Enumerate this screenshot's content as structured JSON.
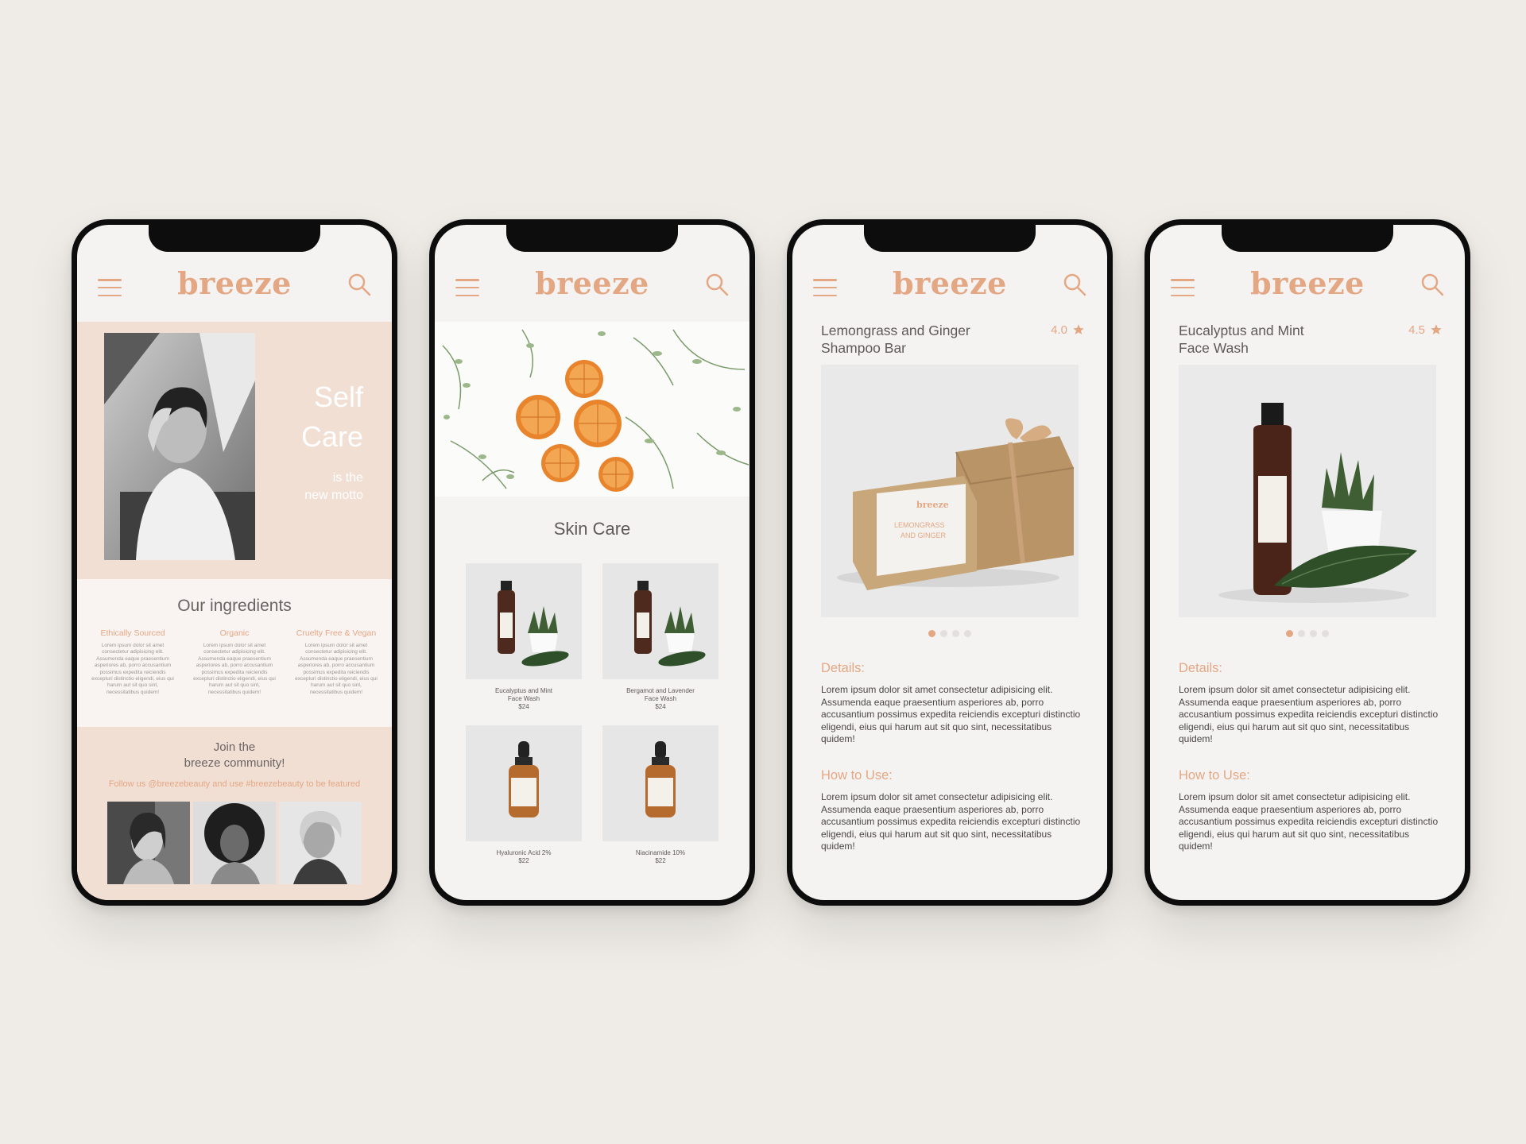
{
  "brand": {
    "logo": "breeze",
    "accent": "#e4a784",
    "blush": "#f1dfd4",
    "icons": {
      "menu": "hamburger-menu-icon",
      "search": "magnifier-search-icon",
      "star": "star-icon"
    }
  },
  "home": {
    "hero": {
      "title_line1": "Self",
      "title_line2": "Care",
      "sub_line1": "is the",
      "sub_line2": "new motto"
    },
    "ingredients": {
      "title": "Our ingredients",
      "columns": [
        {
          "heading": "Ethically Sourced",
          "text": "Lorem ipsum dolor sit amet consectetur adipisicing elit. Assumenda eaque praesentium asperiores ab, porro accusantium possimus expedita reiciendis excepturi distinctio eligendi, eius qui harum aut sit quo sint, necessitatibus quidem!"
        },
        {
          "heading": "Organic",
          "text": "Lorem ipsum dolor sit amet consectetur adipisicing elit. Assumenda eaque praesentium asperiores ab, porro accusantium possimus expedita reiciendis excepturi distinctio eligendi, eius qui harum aut sit quo sint, necessitatibus quidem!"
        },
        {
          "heading": "Cruelty Free & Vegan",
          "text": "Lorem ipsum dolor sit amet consectetur adipisicing elit. Assumenda eaque praesentium asperiores ab, porro accusantium possimus expedita reiciendis excepturi distinctio eligendi, eius qui harum aut sit quo sint, necessitatibus quidem!"
        }
      ]
    },
    "community": {
      "title_line1": "Join the",
      "title_line2": "breeze community!",
      "follow": "Follow us @breezebeauty and use #breezebeauty to be featured"
    }
  },
  "catalog": {
    "title": "Skin Care",
    "products": [
      {
        "name_line1": "Eucalyptus and Mint",
        "name_line2": "Face Wash",
        "price": "$24"
      },
      {
        "name_line1": "Bergamot and Lavender",
        "name_line2": "Face Wash",
        "price": "$24"
      },
      {
        "name_line1": "Hyaluronic Acid 2%",
        "name_line2": "",
        "price": "$22"
      },
      {
        "name_line1": "Niacinamide 10%",
        "name_line2": "",
        "price": "$22"
      }
    ]
  },
  "detail_soap": {
    "name_line1": "Lemongrass and Ginger",
    "name_line2": "Shampoo Bar",
    "rating": "4.0",
    "label_brand": "breeze",
    "label_line1": "LEMONGRASS",
    "label_line2": "AND GINGER",
    "details_heading": "Details:",
    "details_text": "Lorem ipsum dolor sit amet consectetur adipisicing elit. Assumenda eaque praesentium asperiores ab, porro accusantium possimus expedita reiciendis excepturi distinctio eligendi, eius qui harum aut sit quo sint, necessitatibus quidem!",
    "howto_heading": "How to Use:",
    "howto_text": "Lorem ipsum dolor sit amet consectetur adipisicing elit. Assumenda eaque praesentium asperiores ab, porro accusantium possimus expedita reiciendis excepturi distinctio eligendi, eius qui harum aut sit quo sint, necessitatibus quidem!",
    "carousel_count": 4,
    "carousel_active": 1
  },
  "detail_wash": {
    "name_line1": "Eucalyptus and Mint",
    "name_line2": "Face Wash",
    "rating": "4.5",
    "details_heading": "Details:",
    "details_text": "Lorem ipsum dolor sit amet consectetur adipisicing elit. Assumenda eaque praesentium asperiores ab, porro accusantium possimus expedita reiciendis excepturi distinctio eligendi, eius qui harum aut sit quo sint, necessitatibus quidem!",
    "howto_heading": "How to Use:",
    "howto_text": "Lorem ipsum dolor sit amet consectetur adipisicing elit. Assumenda eaque praesentium asperiores ab, porro accusantium possimus expedita reiciendis excepturi distinctio eligendi, eius qui harum aut sit quo sint, necessitatibus quidem!",
    "carousel_count": 4,
    "carousel_active": 1
  }
}
